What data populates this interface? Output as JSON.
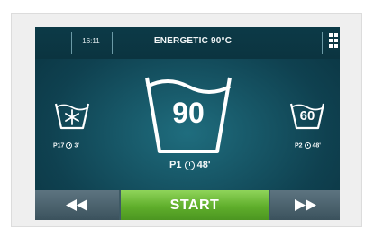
{
  "header": {
    "time": "16:11",
    "program_title": "ENERGETIC 90°C",
    "menu_icon": "grid-menu-icon"
  },
  "programs": {
    "left": {
      "icon": "snowflake-tub-icon",
      "label": "P17",
      "duration": "3'"
    },
    "center": {
      "icon": "tub-icon",
      "temperature": "90",
      "label": "P1",
      "duration": "48'"
    },
    "right": {
      "icon": "tub-icon",
      "temperature": "60",
      "label": "P2",
      "duration": "48'"
    }
  },
  "footer": {
    "previous_icon": "rewind-icon",
    "start_label": "START",
    "next_icon": "fast-forward-icon"
  },
  "colors": {
    "screen_bg": "#0f4150",
    "start_button": "#5fae2b",
    "nav_button": "#4a616c"
  }
}
